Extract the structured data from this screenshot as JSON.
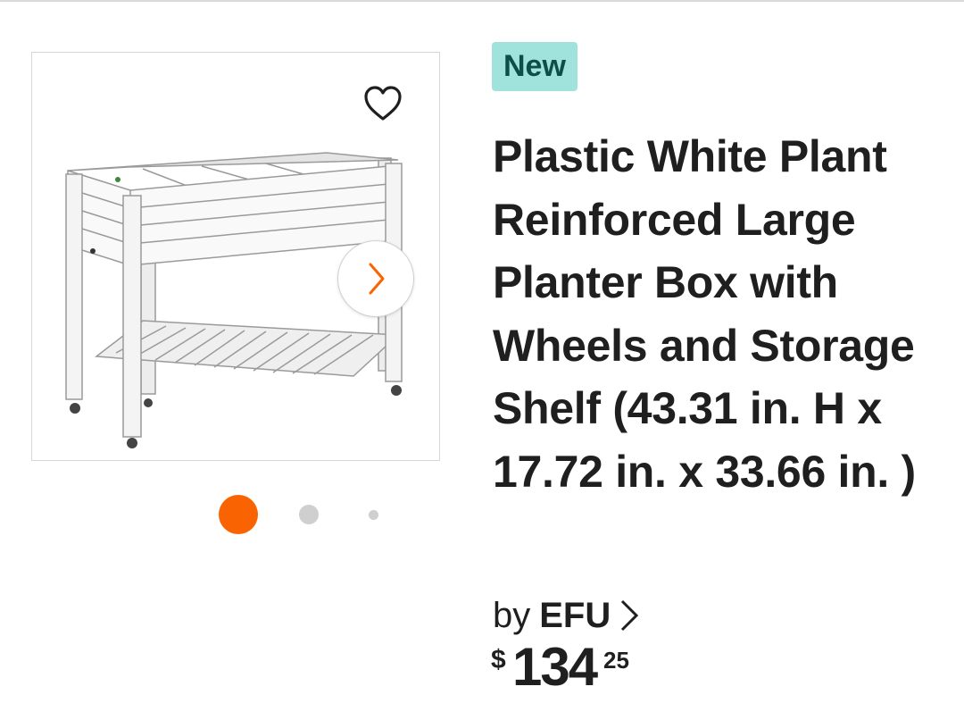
{
  "badge": {
    "label": "New"
  },
  "product": {
    "title": "Plastic White Plant Reinforced Large Planter Box with Wheels and Storage Shelf (43.31 in. H x 17.72 in. x 33.66 in. )",
    "brand_prefix": "by",
    "brand_name": "EFU"
  },
  "price": {
    "currency": "$",
    "dollars": "134",
    "cents": "25"
  },
  "gallery": {
    "image_count": 3,
    "active_index": 1
  },
  "icons": {
    "favorite": "heart-outline-icon",
    "next": "chevron-right-icon",
    "brand_link": "chevron-right-icon"
  },
  "colors": {
    "accent": "#f96302",
    "badge_bg": "#9fe3dc",
    "badge_text": "#0f4d48",
    "text": "#1f1f1f",
    "inactive_dot": "#cfcfcf"
  }
}
